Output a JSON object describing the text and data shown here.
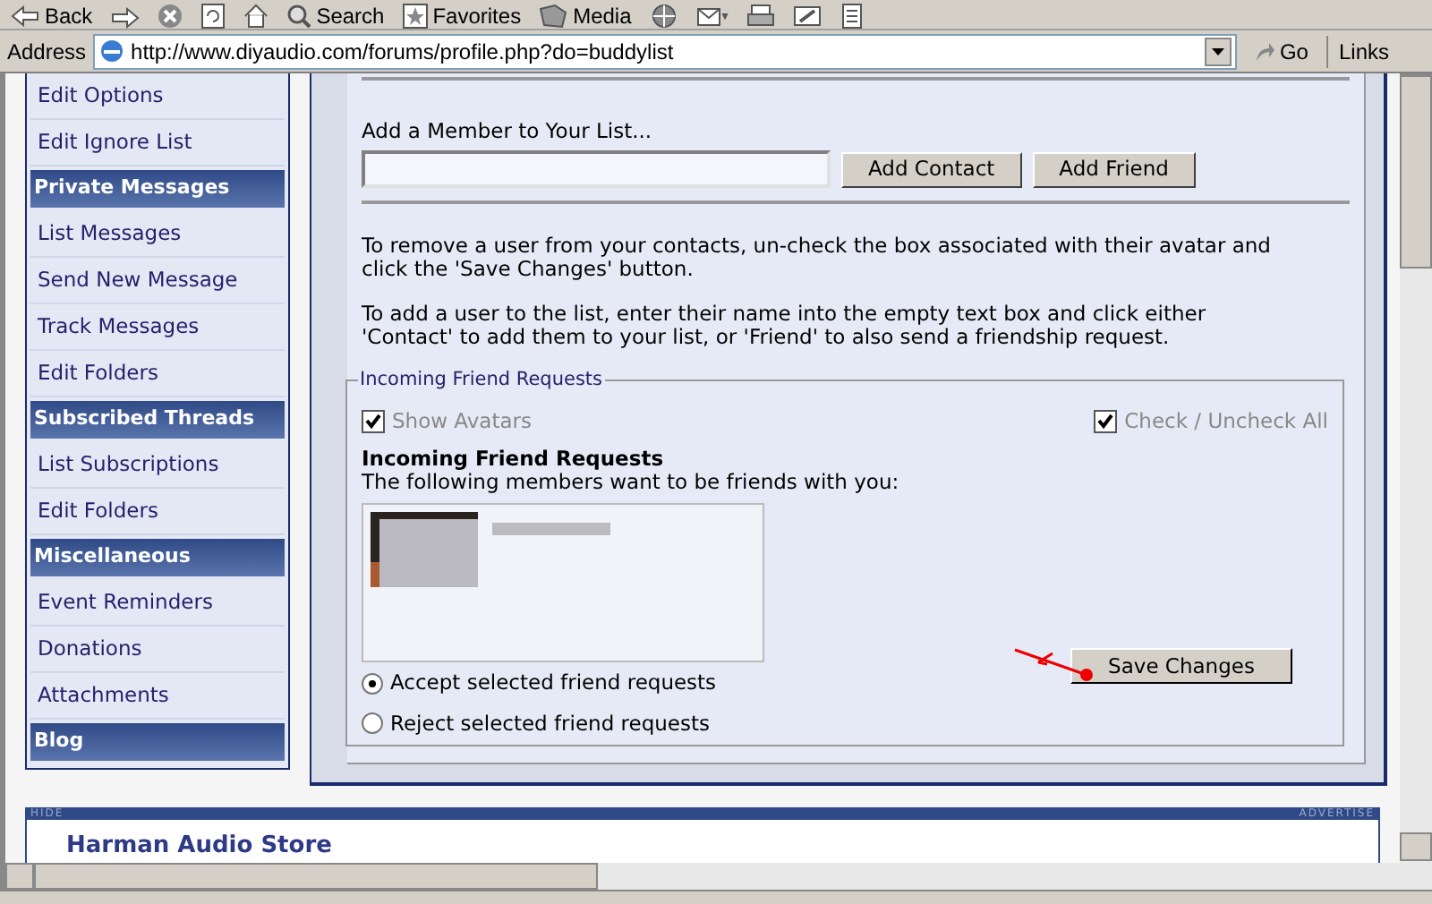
{
  "toolbar": {
    "buttons": [
      {
        "kind": "back",
        "label": "Back"
      },
      {
        "kind": "forward"
      },
      {
        "kind": "stop"
      },
      {
        "kind": "refresh"
      },
      {
        "kind": "home"
      },
      {
        "kind": "search",
        "label": "Search"
      },
      {
        "kind": "favorites",
        "label": "Favorites"
      },
      {
        "kind": "media",
        "label": "Media"
      },
      {
        "kind": "history"
      },
      {
        "kind": "mail"
      },
      {
        "kind": "print"
      },
      {
        "kind": "edit"
      },
      {
        "kind": "discuss"
      }
    ]
  },
  "address_bar": {
    "label": "Address",
    "url": "http://www.diyaudio.com/forums/profile.php?do=buddylist",
    "go": "Go",
    "links": "Links"
  },
  "sidebar": {
    "items": [
      {
        "kind": "link",
        "label": "Edit Options"
      },
      {
        "kind": "link",
        "label": "Edit Ignore List"
      },
      {
        "kind": "header",
        "label": "Private Messages"
      },
      {
        "kind": "link",
        "label": "List Messages"
      },
      {
        "kind": "link",
        "label": "Send New Message"
      },
      {
        "kind": "link",
        "label": "Track Messages"
      },
      {
        "kind": "link",
        "label": "Edit Folders"
      },
      {
        "kind": "header",
        "label": "Subscribed Threads"
      },
      {
        "kind": "link",
        "label": "List Subscriptions"
      },
      {
        "kind": "link",
        "label": "Edit Folders"
      },
      {
        "kind": "header",
        "label": "Miscellaneous"
      },
      {
        "kind": "link",
        "label": "Event Reminders"
      },
      {
        "kind": "link",
        "label": "Donations"
      },
      {
        "kind": "link",
        "label": "Attachments"
      },
      {
        "kind": "header",
        "label": "Blog"
      }
    ]
  },
  "add_member": {
    "label": "Add a Member to Your List...",
    "buttons": [
      "Add Contact",
      "Add Friend"
    ]
  },
  "instructions": [
    "To remove a user from your contacts, un-check the box associated with their avatar and click the 'Save Changes' button.",
    "To add a user to the list, enter their name into the empty text box and click either 'Contact' to add them to your list, or 'Friend' to also send a friendship request."
  ],
  "incoming": {
    "legend": "Incoming Friend Requests",
    "show_avatars": {
      "label": "Show Avatars",
      "checked": true
    },
    "check_all": {
      "label": "Check / Uncheck All",
      "checked": true
    },
    "title": "Incoming Friend Requests",
    "subtitle": "The following members want to be friends with you:",
    "options": [
      {
        "label": "Accept selected friend requests",
        "selected": true
      },
      {
        "label": "Reject selected friend requests",
        "selected": false
      }
    ],
    "save_button": "Save Changes"
  },
  "ad_bar": {
    "left": "HIDE",
    "right": "ADVERTISE",
    "title": "Harman Audio Store"
  }
}
